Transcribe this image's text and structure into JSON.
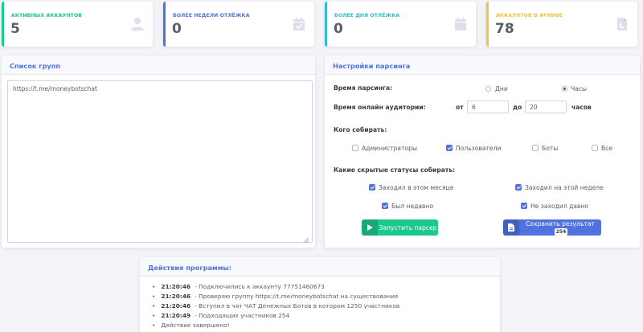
{
  "stats": [
    {
      "label": "АКТИВНЫХ АККАУНТОВ",
      "value": "5",
      "color": "#1cc88a",
      "icon": "user-icon"
    },
    {
      "label": "БОЛЕЕ НЕДЕЛИ ОТЛЁЖКА",
      "value": "0",
      "color": "#4e73df",
      "icon": "calendar-check-icon"
    },
    {
      "label": "БОЛЕЕ ДНЯ ОТЛЁЖКА",
      "value": "0",
      "color": "#36b9cc",
      "icon": "calendar-icon"
    },
    {
      "label": "АККАУНТОВ В АРХИВЕ",
      "value": "78",
      "color": "#f6c23e",
      "icon": "file-icon"
    }
  ],
  "groups": {
    "title": "Список групп",
    "text": "https://t.me/moneybotschat"
  },
  "settings": {
    "title": "Настройки парсинга",
    "time_label": "Время парсинга:",
    "days_label": "Дни",
    "hours_label": "Часы",
    "selected_unit": "hours",
    "online_label": "Время онлайн аудитории:",
    "from_label": "от",
    "from_value": "6",
    "to_label": "до",
    "to_value": "20",
    "hours_suffix": "часов",
    "who_label": "Кого собирать:",
    "who": [
      {
        "label": "Администраторы",
        "checked": false
      },
      {
        "label": "Пользователи",
        "checked": true
      },
      {
        "label": "Боты",
        "checked": false
      },
      {
        "label": "Все",
        "checked": false
      }
    ],
    "status_label": "Какие скрытые статусы собирать:",
    "statuses": [
      {
        "label": "Заходил в этом месяце",
        "checked": true
      },
      {
        "label": "Заходил на этой неделе",
        "checked": true
      },
      {
        "label": "Был недавно",
        "checked": true
      },
      {
        "label": "Не заходил давно",
        "checked": true
      }
    ],
    "run_button": "Запустить парсер",
    "save_button": "Сохранить результат",
    "save_count": "254",
    "run_color": "#1cc88a",
    "save_color": "#4e73df"
  },
  "log": {
    "title": "Действия программы:",
    "entries": [
      {
        "time": "21:20:46",
        "text": "- Подключились к аккаунту 77751460673"
      },
      {
        "time": "21:20:46",
        "text": "- Проверяю группу https://t.me/moneybotschat на существование"
      },
      {
        "time": "21:20:46",
        "text": "- Вступил в чат ЧАТ Денежных Ботов в котором 1250 участников"
      },
      {
        "time": "21:20:49",
        "text": "- Подходящих участников 254"
      },
      {
        "time": "",
        "text": "Действие завершено!"
      }
    ]
  }
}
